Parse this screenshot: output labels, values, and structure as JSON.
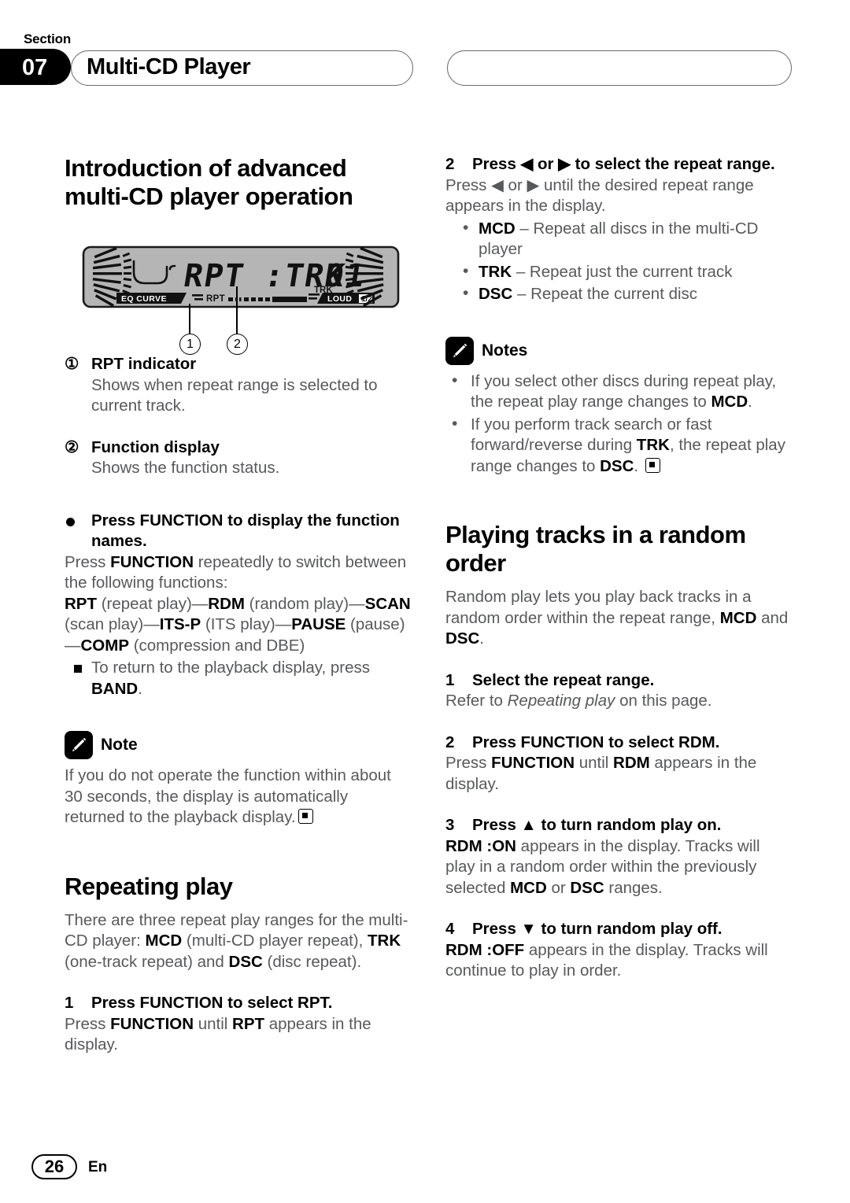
{
  "header": {
    "section_word": "Section",
    "section_number": "07",
    "title": "Multi-CD Player"
  },
  "footer": {
    "page_number": "26",
    "language": "En"
  },
  "display_illustration": {
    "alt_name": "lcd-display-illustration",
    "main_text": "RPT :TRK",
    "track_label": "TRK",
    "track_number": "01",
    "eq_curve_label": "EQ CURVE",
    "rpt_label": "RPT",
    "loud_label": "LOUD",
    "callouts": [
      "1",
      "2"
    ]
  },
  "left_column": {
    "heading": "Introduction of advanced multi-CD player operation",
    "item1": {
      "marker": "①",
      "title": "RPT indicator",
      "body": "Shows when repeat range is selected to current track."
    },
    "item2": {
      "marker": "②",
      "title": "Function display",
      "body": "Shows the function status."
    },
    "function_step": {
      "title": "Press FUNCTION to display the function names.",
      "body_pre": "Press ",
      "body_bold": "FUNCTION",
      "body_post": " repeatedly to switch between the following functions:",
      "chain": [
        {
          "bold": "RPT",
          "plain": " (repeat play)—"
        },
        {
          "bold": "RDM",
          "plain": " (random play)"
        },
        {
          "bold": "",
          "plain": "—"
        },
        {
          "bold": "SCAN",
          "plain": " (scan play)—"
        },
        {
          "bold": "ITS-P",
          "plain": " (ITS play)—"
        },
        {
          "bold": "PAUSE",
          "plain": ""
        },
        {
          "bold": "",
          "plain": " (pause)—"
        },
        {
          "bold": "COMP",
          "plain": " (compression and DBE)"
        }
      ],
      "return_note_pre": "To return to the playback display, press ",
      "return_note_bold": "BAND",
      "return_note_post": "."
    },
    "note": {
      "label": "Note",
      "icon": "pencil-icon",
      "body": "If you do not operate the function within about 30 seconds, the display is automatically returned to the playback display."
    },
    "repeating_play": {
      "heading": "Repeating play",
      "intro_a": "There are three repeat play ranges for the multi-CD player: ",
      "intro_b1": "MCD",
      "intro_c": " (multi-CD player repeat), ",
      "intro_b2": "TRK",
      "intro_d": " (one-track repeat) and ",
      "intro_b3": "DSC",
      "intro_e": " (disc repeat).",
      "step1": {
        "num": "1",
        "title": "Press FUNCTION to select RPT.",
        "body_pre": "Press ",
        "body_b1": "FUNCTION",
        "body_mid": " until ",
        "body_b2": "RPT",
        "body_post": " appears in the display."
      }
    }
  },
  "right_column": {
    "step2": {
      "num": "2",
      "title": "Press ◀ or ▶ to select the repeat range.",
      "body": "Press ◀ or ▶ until the desired repeat range appears in the display.",
      "ranges": [
        {
          "term": "MCD",
          "desc": " – Repeat all discs in the multi-CD player"
        },
        {
          "term": "TRK",
          "desc": " – Repeat just the current track"
        },
        {
          "term": "DSC",
          "desc": " – Repeat the current disc"
        }
      ]
    },
    "notes": {
      "label": "Notes",
      "icon": "pencil-icon",
      "items": [
        {
          "pre": "If you select other discs during repeat play, the repeat play range changes to ",
          "bold": "MCD",
          "post": "."
        },
        {
          "pre": "If you perform track search or fast forward/reverse during ",
          "bold": "TRK",
          "post": ", the repeat play range changes to ",
          "bold2": "DSC",
          "post2": "."
        }
      ]
    },
    "random_order": {
      "heading": "Playing tracks in a random order",
      "intro_a": "Random play lets you play back tracks in a random order within the repeat range, ",
      "intro_b1": "MCD",
      "intro_c": " and ",
      "intro_b2": "DSC",
      "intro_d": ".",
      "step1": {
        "num": "1",
        "title": "Select the repeat range.",
        "body_pre": "Refer to ",
        "body_italic": "Repeating play",
        "body_post": " on this page."
      },
      "step2": {
        "num": "2",
        "title": "Press FUNCTION to select RDM.",
        "body_pre": "Press ",
        "body_b1": "FUNCTION",
        "body_mid": " until ",
        "body_b2": "RDM",
        "body_post": " appears in the display."
      },
      "step3": {
        "num": "3",
        "title": "Press ▲ to turn random play on.",
        "body_b1": "RDM :ON",
        "body_mid": " appears in the display. Tracks will play in a random order within the previously selected ",
        "body_b2": "MCD",
        "body_mid2": " or ",
        "body_b3": "DSC",
        "body_post": " ranges."
      },
      "step4": {
        "num": "4",
        "title": "Press ▼ to turn random play off.",
        "body_b1": "RDM :OFF",
        "body_post": " appears in the display. Tracks will continue to play in order."
      }
    }
  },
  "colors": {
    "body_text": "#58595b",
    "bold_text": "#000000",
    "tab_background": "#000000",
    "pill_border": "#6d6e71",
    "lcd_background": "#b3b3b3"
  }
}
